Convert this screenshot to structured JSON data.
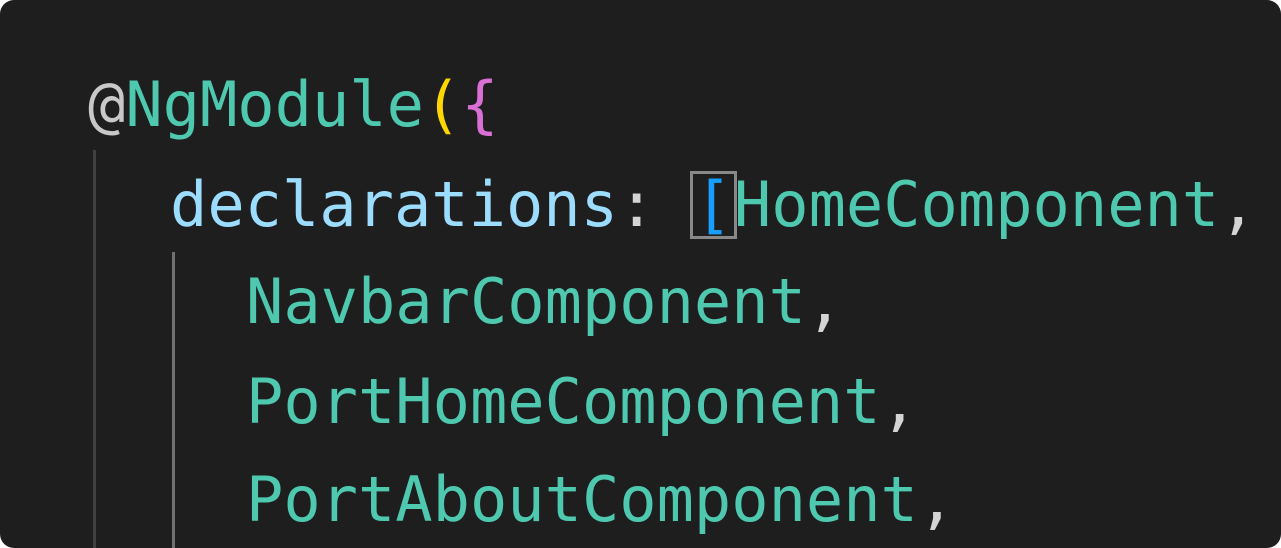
{
  "colors": {
    "background": "#1e1e1e",
    "decorator": "#d7ba7d",
    "property": "#9cdcfe",
    "class_name": "#4ec9b0",
    "punctuation": "#d4d4d4",
    "brace_level_1": "#ffd700",
    "brace_level_2": "#da70d6",
    "bracket_level_3": "#179fff",
    "indent_guide": "#404040"
  },
  "code": {
    "line1": {
      "at": "@",
      "decorator": "NgModule",
      "paren_open": "(",
      "brace_open": "{"
    },
    "line2": {
      "property": "declarations",
      "colon": ": ",
      "bracket_open": "[",
      "first_item": "HomeComponent",
      "comma": ","
    },
    "items": [
      {
        "name": "NavbarComponent",
        "comma": ","
      },
      {
        "name": "PortHomeComponent",
        "comma": ","
      },
      {
        "name": "PortAboutComponent",
        "comma": ","
      }
    ]
  }
}
